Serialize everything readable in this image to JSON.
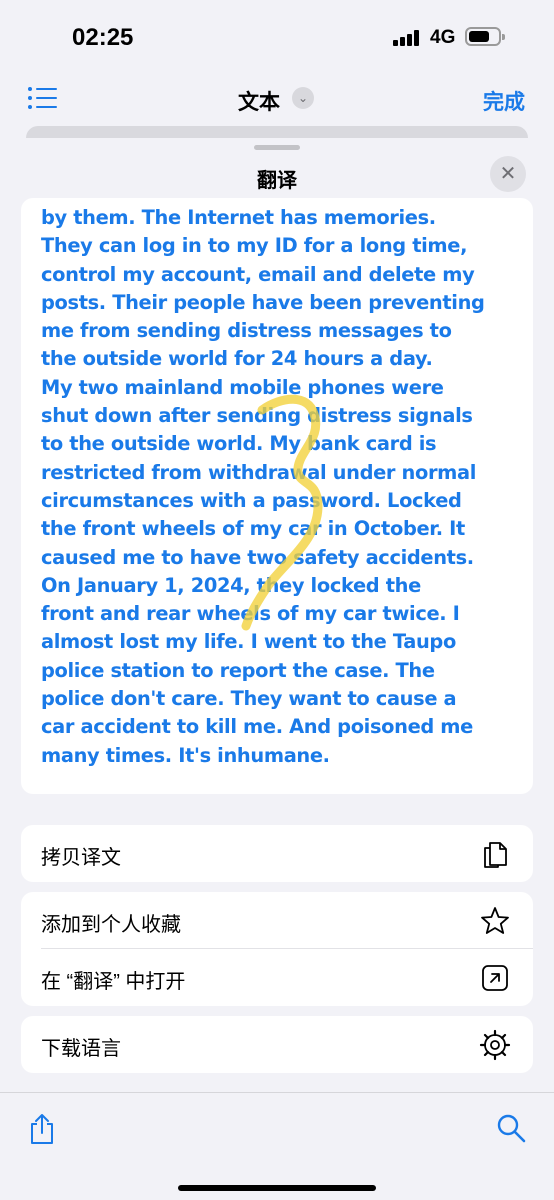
{
  "status_bar": {
    "time": "02:25",
    "network": "4G"
  },
  "nav": {
    "title": "文本",
    "done_label": "完成"
  },
  "sheet": {
    "title": "翻译",
    "translation_lines": [
      "by them. The Internet has memories.",
      "They can log in to my ID for a long time,",
      "control my account, email and delete my",
      "posts. Their people have been preventing",
      "me from sending distress messages to",
      "the outside world for 24 hours a day.",
      "My two mainland mobile phones were",
      "shut down after sending distress signals",
      "to the outside world. My bank card is",
      "restricted from withdrawal under normal",
      "circumstances with a password. Locked",
      "the front wheels of my car in October. It",
      "caused me to have two safety accidents.",
      "On January 1, 2024, they locked the",
      "front and rear wheels of my car twice. I",
      "almost lost my life. I went to the Taupo",
      "police station to report the case. The",
      "police don't care. They want to cause a",
      "car accident to kill me. And poisoned me",
      "many times. It's inhumane."
    ]
  },
  "actions": {
    "copy_translation": "拷贝译文",
    "add_favorites": "添加到个人收藏",
    "open_in_translate": "在 “翻译” 中打开",
    "download_languages": "下载语言"
  },
  "icons": {
    "list": "list-icon",
    "chevron": "chevron-down-icon",
    "close": "close-icon",
    "play": "play-icon",
    "copy": "copy-icon",
    "star": "star-icon",
    "open": "open-external-icon",
    "download": "gear-icon",
    "share": "share-icon",
    "search": "search-icon"
  },
  "colors": {
    "accent": "#1a7ae8",
    "highlight_scribble": "#f2d13a"
  }
}
